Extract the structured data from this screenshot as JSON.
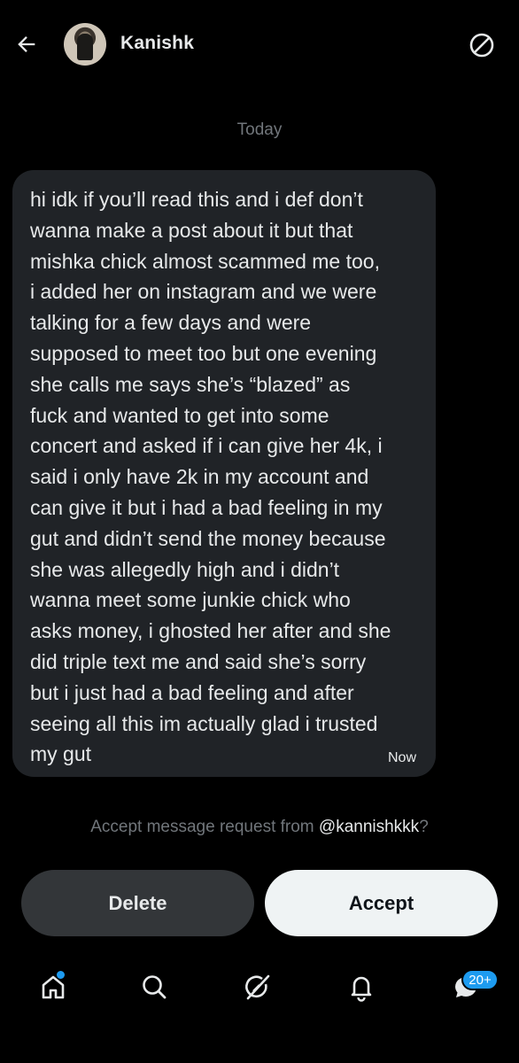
{
  "header": {
    "contact_name": "Kanishk",
    "back_icon": "arrow-left-icon",
    "block_icon": "block-icon"
  },
  "conversation": {
    "date_separator": "Today",
    "messages": [
      {
        "text": "hi idk if you’ll read this and i def don’t\nwanna make a post about it but that\nmishka chick almost scammed me too,\ni added her on instagram and we were\ntalking for a few days and were\nsupposed to meet too but one evening\nshe calls me says she’s “blazed” as\nfuck and wanted to get into some\nconcert and asked if i can give her 4k, i\nsaid i only have 2k in my account and\ncan give it but i had a bad feeling in my\ngut and didn’t send the money because\nshe was allegedly high and i didn’t\nwanna meet some junkie chick who\nasks money, i ghosted her after and she\ndid triple text me and said she’s sorry\nbut i just had a bad feeling and after\nseeing all this im actually glad i trusted\nmy gut",
        "time": "Now"
      }
    ]
  },
  "request": {
    "prefix": "Accept message request from ",
    "handle": "@kannishkkk",
    "suffix": "?",
    "delete_label": "Delete",
    "accept_label": "Accept"
  },
  "tabbar": {
    "items": [
      "home-icon",
      "search-icon",
      "grok-icon",
      "notifications-icon",
      "messages-icon"
    ],
    "messages_badge": "20+",
    "accent": "#1d9bf0"
  }
}
